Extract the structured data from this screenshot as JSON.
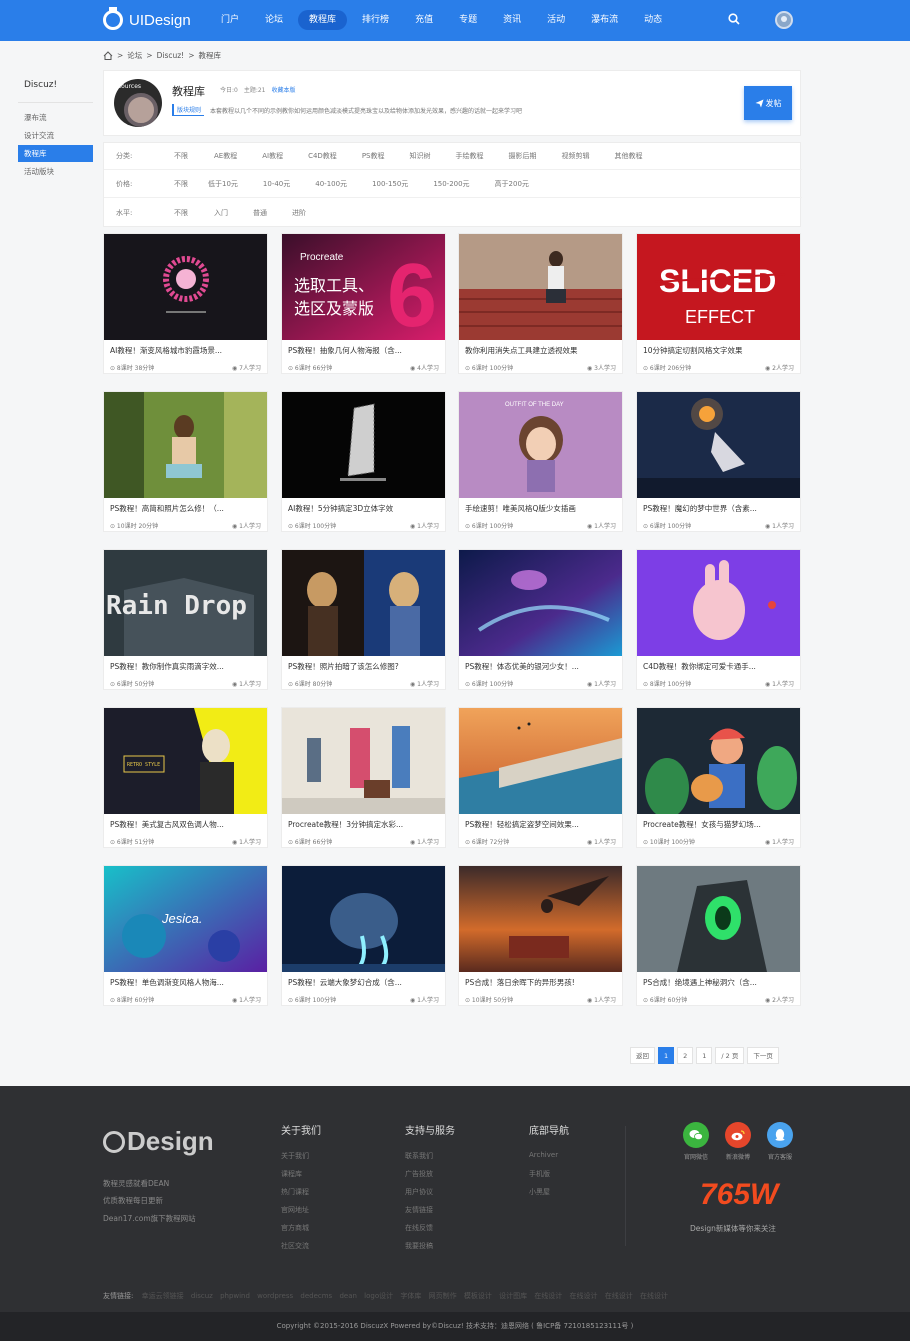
{
  "brand": {
    "name": "UIDesign"
  },
  "nav": [
    "门户",
    "论坛",
    "教程库",
    "排行榜",
    "充值",
    "专题",
    "资讯",
    "活动",
    "瀑布流",
    "动态"
  ],
  "nav_active_index": 2,
  "breadcrumb": [
    "论坛",
    "Discuz!",
    "教程库"
  ],
  "sidebar": {
    "title": "Discuz!",
    "items": [
      "瀑布流",
      "设计交流",
      "教程库",
      "活动版块"
    ],
    "active_index": 2
  },
  "forum": {
    "title": "教程库",
    "today": "今日:0",
    "topics": "主题:21",
    "favorite": "收藏本版",
    "rules_tag": "版块规则",
    "description": "本套教程以几个不同的示例教你如何运用颜色减淡模式提亮珠宝以及给物体添加发光效果，感兴趣的话就一起来学习吧",
    "avatar_text": "sources",
    "post_button": "发帖"
  },
  "filters": [
    {
      "label": "分类:",
      "options": [
        "不限",
        "AE教程",
        "AI教程",
        "C4D教程",
        "PS教程",
        "知识树",
        "手绘教程",
        "摄影后期",
        "视频剪辑",
        "其他教程"
      ]
    },
    {
      "label": "价格:",
      "options": [
        "不限",
        "低于10元",
        "10-40元",
        "40-100元",
        "100-150元",
        "150-200元",
        "高于200元"
      ]
    },
    {
      "label": "水平:",
      "options": [
        "不限",
        "入门",
        "普通",
        "进阶"
      ]
    }
  ],
  "cards": [
    {
      "title": "AI教程！渐变风格城市豹霞场景...",
      "meta": "8课时 38分钟",
      "students": "7人学习"
    },
    {
      "title": "PS教程！抽象几何人物海报（含...",
      "meta": "6课时 66分钟",
      "students": "4人学习"
    },
    {
      "title": "教你利用消失点工具建立透视效果",
      "meta": "6课时 100分钟",
      "students": "3人学习"
    },
    {
      "title": "10分钟搞定切割风格文字效果",
      "meta": "6课时 206分钟",
      "students": "2人学习"
    },
    {
      "title": "PS教程！高简和照片怎么修！（...",
      "meta": "10课时 20分钟",
      "students": "1人学习"
    },
    {
      "title": "AI教程！5分钟搞定3D立体字效",
      "meta": "6课时 100分钟",
      "students": "1人学习"
    },
    {
      "title": "手绘速剪！唯美风格Q版少女插画",
      "meta": "6课时 100分钟",
      "students": "1人学习"
    },
    {
      "title": "PS教程！魔幻的梦中世界（含素...",
      "meta": "6课时 100分钟",
      "students": "1人学习"
    },
    {
      "title": "PS教程！教你制作真实雨滴字效...",
      "meta": "6课时 50分钟",
      "students": "1人学习"
    },
    {
      "title": "PS教程！照片拍暗了该怎么修图?",
      "meta": "6课时 80分钟",
      "students": "1人学习"
    },
    {
      "title": "PS教程！体态优美的银河少女！...",
      "meta": "6课时 100分钟",
      "students": "1人学习"
    },
    {
      "title": "C4D教程！教你绑定可爱卡通手...",
      "meta": "8课时 100分钟",
      "students": "1人学习"
    },
    {
      "title": "PS教程！美式复古风双色调人物...",
      "meta": "6课时 51分钟",
      "students": "1人学习"
    },
    {
      "title": "Procreate教程！3分钟搞定水彩...",
      "meta": "6课时 66分钟",
      "students": "1人学习"
    },
    {
      "title": "PS教程！轻松搞定盗梦空间效果...",
      "meta": "6课时 72分钟",
      "students": "1人学习"
    },
    {
      "title": "Procreate教程！女孩与猫梦幻场...",
      "meta": "10课时 100分钟",
      "students": "1人学习"
    },
    {
      "title": "PS教程！单色调渐变风格人物海...",
      "meta": "8课时 60分钟",
      "students": "1人学习"
    },
    {
      "title": "PS教程！云端大象梦幻合成（含...",
      "meta": "6课时 100分钟",
      "students": "1人学习"
    },
    {
      "title": "PS合成！落日余晖下的异形男孩!",
      "meta": "10课时 50分钟",
      "students": "1人学习"
    },
    {
      "title": "PS合成！绝境遇上神秘洞穴（含...",
      "meta": "6课时 60分钟",
      "students": "2人学习"
    }
  ],
  "thumb_texts": {
    "procreate": "Procreate",
    "procreate_line1": "选取工具、",
    "procreate_line2": "选区及蒙版",
    "sliced": "SLICED",
    "effect": "EFFECT",
    "rain": "Rain Drop",
    "outfit": "OUTFIT OF THE DAY",
    "retro": "RETRO STYLE",
    "jesica": "Jesica."
  },
  "pager": {
    "prev": "返回",
    "pages": [
      "1",
      "2"
    ],
    "input": "1",
    "total": "/ 2 页",
    "next": "下一页"
  },
  "footer": {
    "logo": "Design",
    "lines": [
      "教程灵感就看DEAN",
      "优质教程每日更新",
      "Dean17.com旗下教程网站"
    ],
    "cols": [
      {
        "title": "关于我们",
        "links": [
          "关于我们",
          "课程库",
          "热门课程",
          "官网地址",
          "官方商城",
          "社区交流"
        ]
      },
      {
        "title": "支持与服务",
        "links": [
          "联系我们",
          "广告投放",
          "用户协议",
          "友情链接",
          "在线反馈",
          "我要投稿"
        ]
      },
      {
        "title": "底部导航",
        "links": [
          "Archiver",
          "手机版",
          "小黑屋"
        ]
      }
    ],
    "social": [
      {
        "label": "官网微信",
        "color": "#3bb53f"
      },
      {
        "label": "新浪微博",
        "color": "#e6462b"
      },
      {
        "label": "官方客服",
        "color": "#4aa3ee"
      }
    ],
    "big_number": "765W",
    "follow": "Design新媒体等你来关注",
    "links_label": "友情链接:",
    "links": [
      "幸运云领链接",
      "discuz",
      "phpwind",
      "wordpress",
      "dedecms",
      "dean",
      "logo设计",
      "字体库",
      "网页制作",
      "模板设计",
      "设计图库",
      "在线设计",
      "在线设计",
      "在线设计",
      "在线设计"
    ],
    "copyright": "Copyright  ©2015-2016  DiscuzX  Powered by©Discuz!  技术支持：迪恩网络      ( 鲁ICP备 7210185123111号 )"
  }
}
